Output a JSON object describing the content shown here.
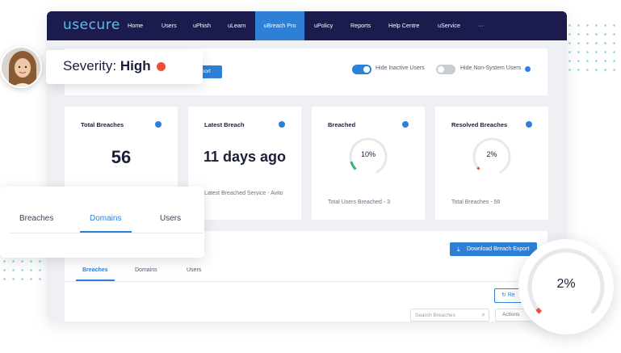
{
  "navbar": {
    "logo": "usecure",
    "items": [
      {
        "label": "Home"
      },
      {
        "label": "Users"
      },
      {
        "label": "uPhish"
      },
      {
        "label": "uLearn"
      },
      {
        "label": "uBreach Pro",
        "active": true
      },
      {
        "label": "uPolicy"
      },
      {
        "label": "Reports"
      },
      {
        "label": "Help Centre"
      },
      {
        "label": "uService"
      },
      {
        "label": "···"
      }
    ]
  },
  "filters": {
    "export_partial_label": "eport",
    "hide_inactive_users": {
      "label": "Hide Inactive Users",
      "on": true
    },
    "hide_non_system_users": {
      "label": "Hide Non-System Users",
      "on": false
    }
  },
  "stats": {
    "total_breaches": {
      "title": "Total Breaches",
      "value": "56"
    },
    "latest_breach": {
      "title": "Latest Breach",
      "value": "11 days ago",
      "footer": "Latest Breached Service - Avito"
    },
    "breached": {
      "title": "Breached",
      "percent_label": "10%",
      "percent": 10,
      "footer": "Total Users Breached - 3"
    },
    "resolved_breaches": {
      "title": "Resolved Breaches",
      "percent_label": "2%",
      "percent": 2,
      "footer": "Total Breaches - 56"
    }
  },
  "breach_table": {
    "download_button": "Download Breach Export",
    "tabs": [
      "Breaches",
      "Domains",
      "Users"
    ],
    "active_tab": "Breaches",
    "refresh_label": "Re",
    "search_placeholder": "Search Breaches",
    "actions_label": "Actions"
  },
  "overlays": {
    "severity": {
      "label": "Severity:",
      "value": "High"
    },
    "tabs": [
      "Breaches",
      "Domains",
      "Users"
    ],
    "active_tab": "Domains",
    "gauge": {
      "percent_label": "2%",
      "percent": 2
    }
  },
  "colors": {
    "navbar": "#1b1b4d",
    "accent": "#2e80d7",
    "logo": "#5cc0ea",
    "severity_high": "#f04e37",
    "gauge_good": "#3cb371",
    "gauge_bad": "#f04e37",
    "gauge_track": "#e6e8ee"
  }
}
